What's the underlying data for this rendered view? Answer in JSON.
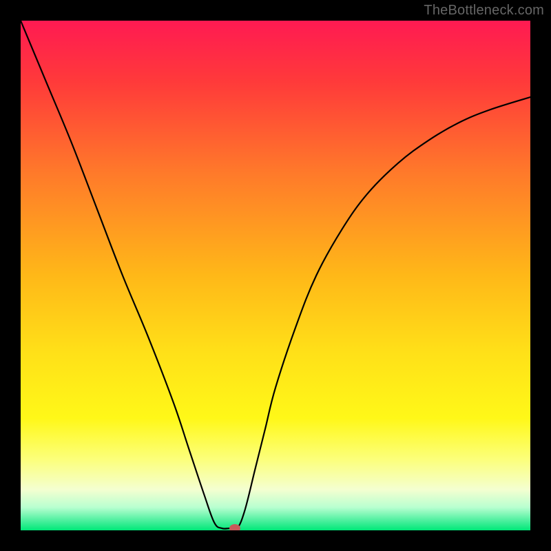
{
  "watermark": "TheBottleneck.com",
  "chart_data": {
    "type": "line",
    "title": "",
    "xlabel": "",
    "ylabel": "",
    "xlim": [
      0,
      100
    ],
    "ylim": [
      0,
      100
    ],
    "gradient_stops": [
      {
        "offset": 0.0,
        "color": "#ff1a52"
      },
      {
        "offset": 0.12,
        "color": "#ff3a3a"
      },
      {
        "offset": 0.3,
        "color": "#ff7a2a"
      },
      {
        "offset": 0.5,
        "color": "#ffb818"
      },
      {
        "offset": 0.65,
        "color": "#ffe018"
      },
      {
        "offset": 0.78,
        "color": "#fff818"
      },
      {
        "offset": 0.86,
        "color": "#fcff7a"
      },
      {
        "offset": 0.92,
        "color": "#f4ffd0"
      },
      {
        "offset": 0.955,
        "color": "#b8ffd0"
      },
      {
        "offset": 0.98,
        "color": "#50f0a0"
      },
      {
        "offset": 1.0,
        "color": "#00e878"
      }
    ],
    "series": [
      {
        "name": "bottleneck-curve",
        "points": [
          {
            "x": 0,
            "y": 100
          },
          {
            "x": 5,
            "y": 88
          },
          {
            "x": 10,
            "y": 76
          },
          {
            "x": 15,
            "y": 63
          },
          {
            "x": 20,
            "y": 50
          },
          {
            "x": 25,
            "y": 38
          },
          {
            "x": 30,
            "y": 25
          },
          {
            "x": 33,
            "y": 16
          },
          {
            "x": 36,
            "y": 7
          },
          {
            "x": 38,
            "y": 1.5
          },
          {
            "x": 39.5,
            "y": 0.4
          },
          {
            "x": 41,
            "y": 0.4
          },
          {
            "x": 42.5,
            "y": 0.4
          },
          {
            "x": 44,
            "y": 4
          },
          {
            "x": 46,
            "y": 12
          },
          {
            "x": 48,
            "y": 20
          },
          {
            "x": 50,
            "y": 28
          },
          {
            "x": 54,
            "y": 40
          },
          {
            "x": 58,
            "y": 50
          },
          {
            "x": 63,
            "y": 59
          },
          {
            "x": 68,
            "y": 66
          },
          {
            "x": 74,
            "y": 72
          },
          {
            "x": 80,
            "y": 76.5
          },
          {
            "x": 86,
            "y": 80
          },
          {
            "x": 92,
            "y": 82.5
          },
          {
            "x": 100,
            "y": 85
          }
        ]
      }
    ],
    "marker": {
      "x": 42,
      "y": 0.4,
      "color": "#c95a5a"
    }
  }
}
